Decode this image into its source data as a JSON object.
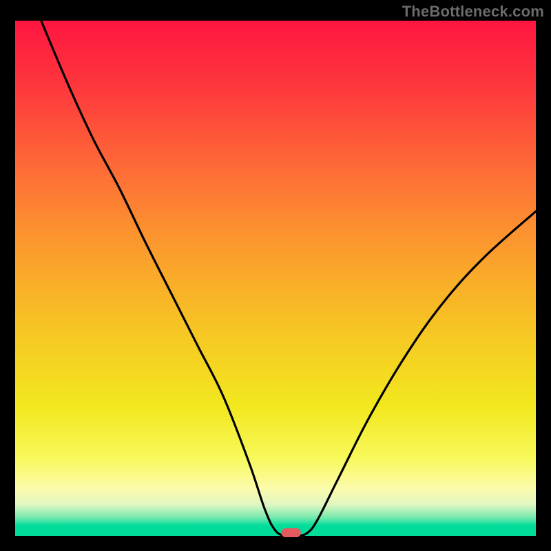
{
  "watermark": "TheBottleneck.com",
  "colors": {
    "frame": "#000000",
    "curve": "#000000",
    "marker": "#e55a5f",
    "gradient_top": "#fe1540",
    "gradient_bottom": "#00dd9b"
  },
  "chart_data": {
    "type": "line",
    "title": "",
    "xlabel": "",
    "ylabel": "",
    "xlim": [
      0,
      100
    ],
    "ylim": [
      0,
      100
    ],
    "grid": false,
    "legend": false,
    "series": [
      {
        "name": "bottleneck-curve",
        "x": [
          5,
          10,
          15,
          20,
          25,
          30,
          35,
          40,
          45,
          48,
          50,
          52,
          54,
          56,
          58,
          62,
          68,
          75,
          82,
          90,
          100
        ],
        "y": [
          100,
          88,
          77,
          67.5,
          57,
          47,
          37,
          27,
          14,
          5,
          1,
          0,
          0,
          0.5,
          3,
          11,
          23,
          35,
          45,
          54,
          63
        ]
      }
    ],
    "minimum_marker": {
      "x": 53,
      "y": 0,
      "shape": "pill"
    },
    "annotations": []
  }
}
